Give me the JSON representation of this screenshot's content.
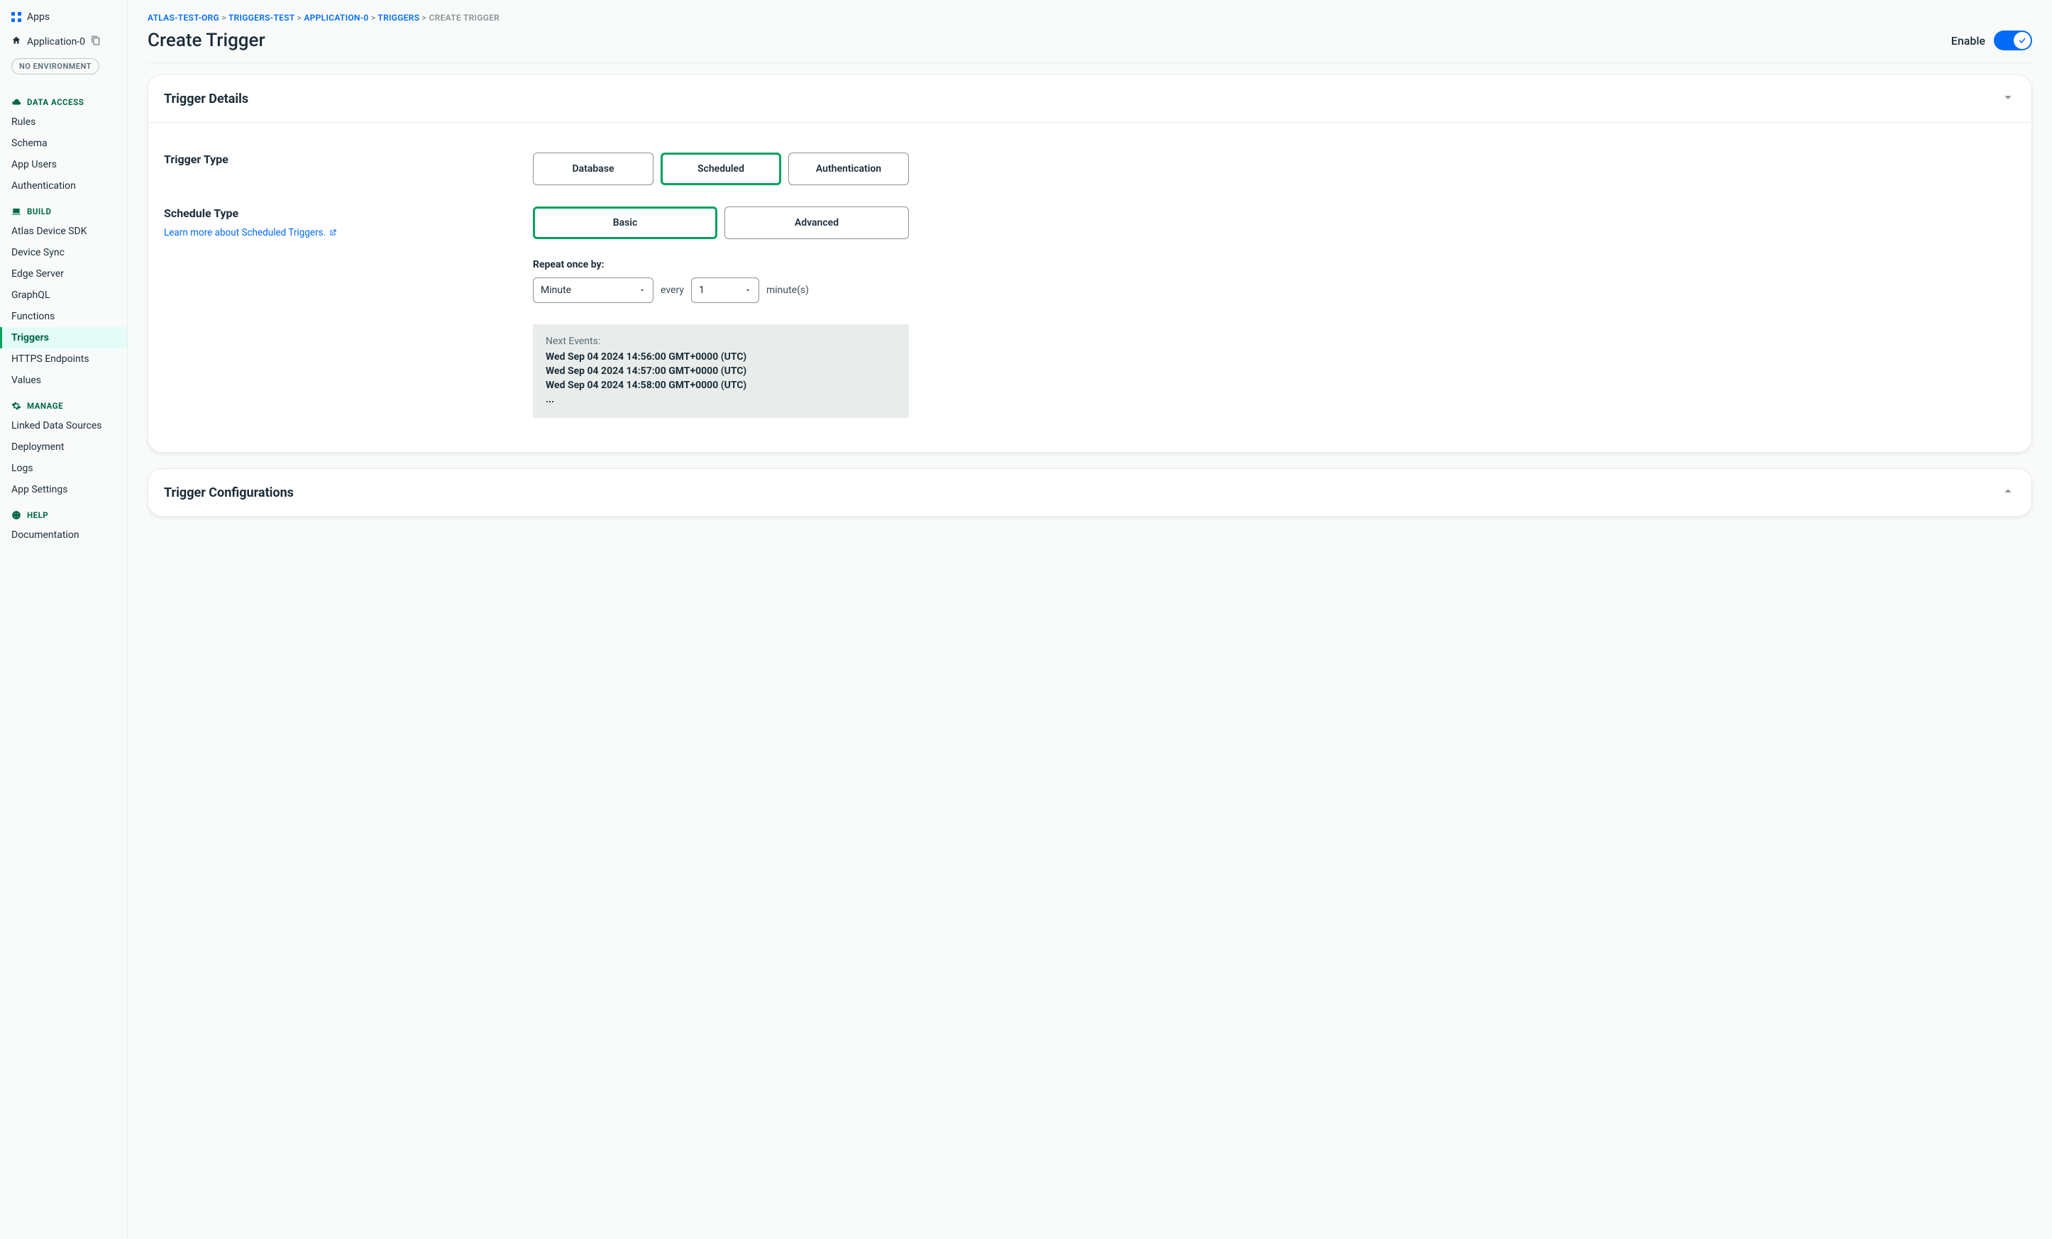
{
  "sidebar": {
    "apps_label": "Apps",
    "app_name": "Application-0",
    "env_badge": "NO ENVIRONMENT",
    "sections": {
      "data_access": {
        "title": "DATA ACCESS",
        "items": [
          "Rules",
          "Schema",
          "App Users",
          "Authentication"
        ]
      },
      "build": {
        "title": "BUILD",
        "items": [
          "Atlas Device SDK",
          "Device Sync",
          "Edge Server",
          "GraphQL",
          "Functions",
          "Triggers",
          "HTTPS Endpoints",
          "Values"
        ]
      },
      "manage": {
        "title": "MANAGE",
        "items": [
          "Linked Data Sources",
          "Deployment",
          "Logs",
          "App Settings"
        ]
      },
      "help": {
        "title": "HELP",
        "items": [
          "Documentation"
        ]
      }
    },
    "active_item": "Triggers"
  },
  "breadcrumb": {
    "parts": [
      "ATLAS-TEST-ORG",
      "TRIGGERS-TEST",
      "APPLICATION-0",
      "TRIGGERS"
    ],
    "current": "CREATE TRIGGER"
  },
  "page": {
    "title": "Create Trigger",
    "enable_label": "Enable",
    "enable_on": true
  },
  "details": {
    "card_title": "Trigger Details",
    "trigger_type_label": "Trigger Type",
    "trigger_type_options": [
      "Database",
      "Scheduled",
      "Authentication"
    ],
    "trigger_type_selected": "Scheduled",
    "schedule_type_label": "Schedule Type",
    "schedule_learn_link": "Learn more about Scheduled Triggers.",
    "schedule_type_options": [
      "Basic",
      "Advanced"
    ],
    "schedule_type_selected": "Basic",
    "repeat_label": "Repeat once by:",
    "repeat_unit": "Minute",
    "repeat_every": "every",
    "repeat_value": "1",
    "repeat_suffix": "minute(s)",
    "next_events_label": "Next Events:",
    "next_events": [
      "Wed Sep 04 2024 14:56:00 GMT+0000 (UTC)",
      "Wed Sep 04 2024 14:57:00 GMT+0000 (UTC)",
      "Wed Sep 04 2024 14:58:00 GMT+0000 (UTC)"
    ],
    "next_events_more": "..."
  },
  "configurations": {
    "card_title": "Trigger Configurations"
  }
}
